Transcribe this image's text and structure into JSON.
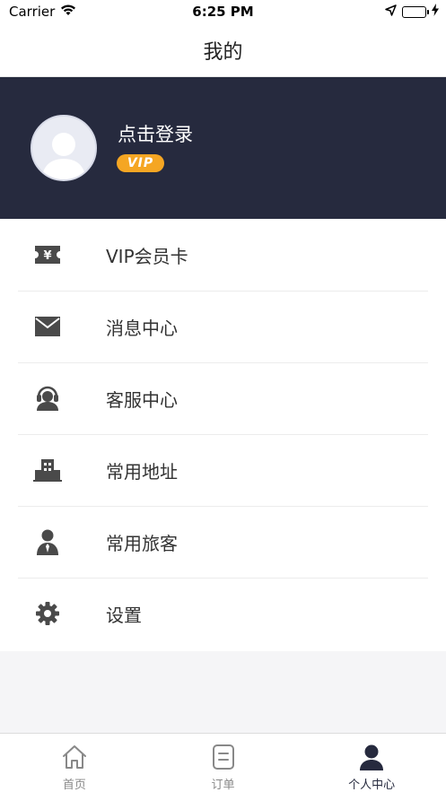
{
  "status_bar": {
    "carrier": "Carrier",
    "time": "6:25 PM",
    "battery_level": 1.0
  },
  "nav": {
    "title": "我的"
  },
  "profile": {
    "login_label": "点击登录",
    "vip_label": "VIP"
  },
  "menu": {
    "items": [
      {
        "label": "VIP会员卡",
        "icon": "ticket-icon"
      },
      {
        "label": "消息中心",
        "icon": "mail-icon"
      },
      {
        "label": "客服中心",
        "icon": "headset-icon"
      },
      {
        "label": "常用地址",
        "icon": "building-icon"
      },
      {
        "label": "常用旅客",
        "icon": "person-tie-icon"
      },
      {
        "label": "设置",
        "icon": "gear-icon"
      }
    ]
  },
  "tabs": [
    {
      "label": "首页",
      "icon": "home-icon",
      "active": false
    },
    {
      "label": "订单",
      "icon": "order-icon",
      "active": false
    },
    {
      "label": "个人中心",
      "icon": "user-icon",
      "active": true
    }
  ],
  "colors": {
    "header_bg": "#262a3e",
    "vip_badge": "#f5a623",
    "icon_gray": "#4a4a4a",
    "battery_green": "#4cd964"
  }
}
